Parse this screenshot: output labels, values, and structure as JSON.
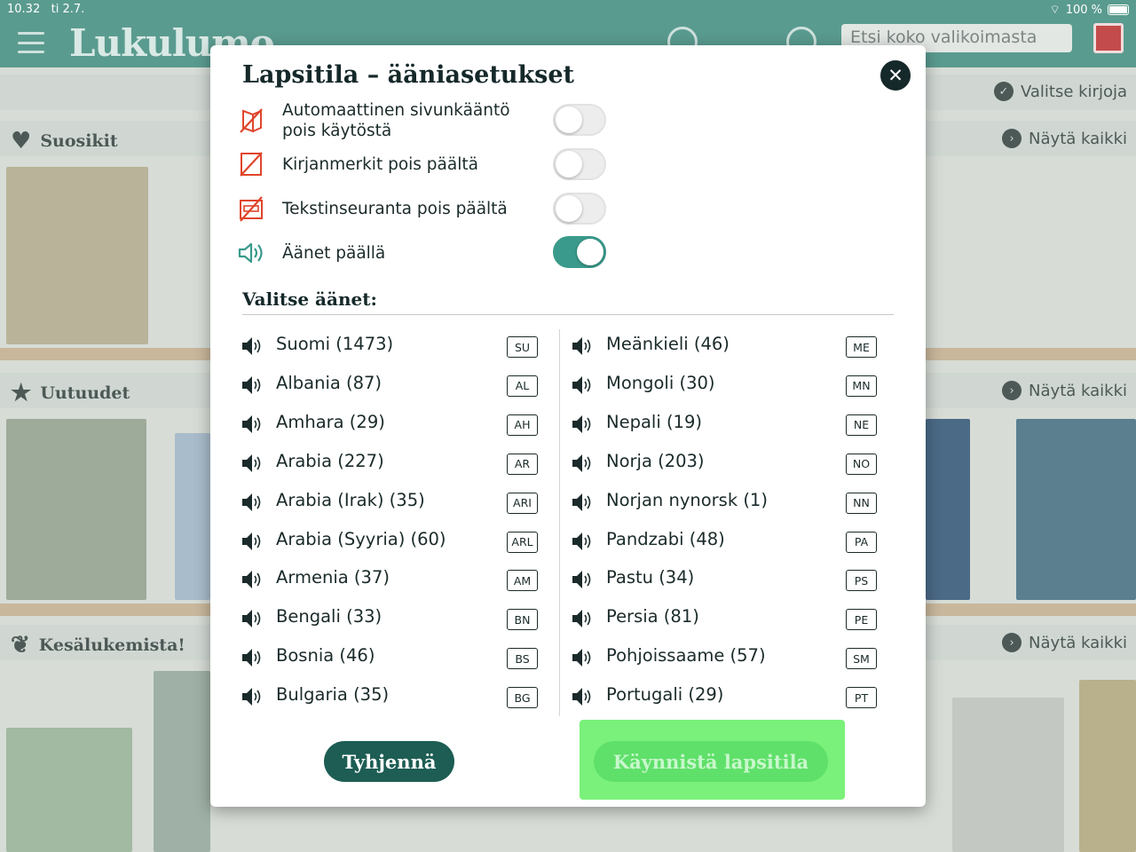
{
  "status_bar": {
    "time": "10.32",
    "date": "ti 2.7.",
    "battery": "100 %"
  },
  "header": {
    "logo": "Lukulumo",
    "search_placeholder": "Etsi koko valikoimasta"
  },
  "background": {
    "select_books": "Valitse kirjoja",
    "sections": [
      {
        "title": "Suosikit",
        "link": "Näytä kaikki"
      },
      {
        "title": "Uutuudet",
        "link": "Näytä kaikki"
      },
      {
        "title": "Kesälukemista!",
        "link": "Näytä kaikki"
      }
    ]
  },
  "modal": {
    "title": "Lapsitila – ääniasetukset",
    "settings": [
      {
        "label": "Automaattinen sivunkääntö pois käytöstä",
        "icon": "page-turn-off-icon",
        "on": false
      },
      {
        "label": "Kirjanmerkit pois päältä",
        "icon": "bookmark-off-icon",
        "on": false
      },
      {
        "label": "Tekstinseuranta pois päältä",
        "icon": "text-tracking-off-icon",
        "on": false
      },
      {
        "label": "Äänet päällä",
        "icon": "speaker-on-icon",
        "on": true
      }
    ],
    "voices_label": "Valitse äänet:",
    "voices_left": [
      {
        "label": "Suomi (1473)",
        "code": "SU"
      },
      {
        "label": "Albania (87)",
        "code": "AL"
      },
      {
        "label": "Amhara (29)",
        "code": "AH"
      },
      {
        "label": "Arabia (227)",
        "code": "AR"
      },
      {
        "label": "Arabia (Irak) (35)",
        "code": "ARI"
      },
      {
        "label": "Arabia (Syyria) (60)",
        "code": "ARL"
      },
      {
        "label": "Armenia (37)",
        "code": "AM"
      },
      {
        "label": "Bengali (33)",
        "code": "BN"
      },
      {
        "label": "Bosnia (46)",
        "code": "BS"
      },
      {
        "label": "Bulgaria (35)",
        "code": "BG"
      }
    ],
    "voices_right": [
      {
        "label": "Meänkieli (46)",
        "code": "ME"
      },
      {
        "label": "Mongoli (30)",
        "code": "MN"
      },
      {
        "label": "Nepali (19)",
        "code": "NE"
      },
      {
        "label": "Norja (203)",
        "code": "NO"
      },
      {
        "label": "Norjan nynorsk (1)",
        "code": "NN"
      },
      {
        "label": "Pandzabi (48)",
        "code": "PA"
      },
      {
        "label": "Pastu (34)",
        "code": "PS"
      },
      {
        "label": "Persia (81)",
        "code": "PE"
      },
      {
        "label": "Pohjoissaame (57)",
        "code": "SM"
      },
      {
        "label": "Portugali (29)",
        "code": "PT"
      }
    ],
    "clear_button": "Tyhjennä",
    "start_button": "Käynnistä lapsitila"
  },
  "colors": {
    "brand": "#5a9b8f",
    "toggle_on": "#3a9a8b",
    "clear_button": "#1d5d53",
    "start_button": "#5fe06a",
    "warning_icon": "#e0452b"
  }
}
